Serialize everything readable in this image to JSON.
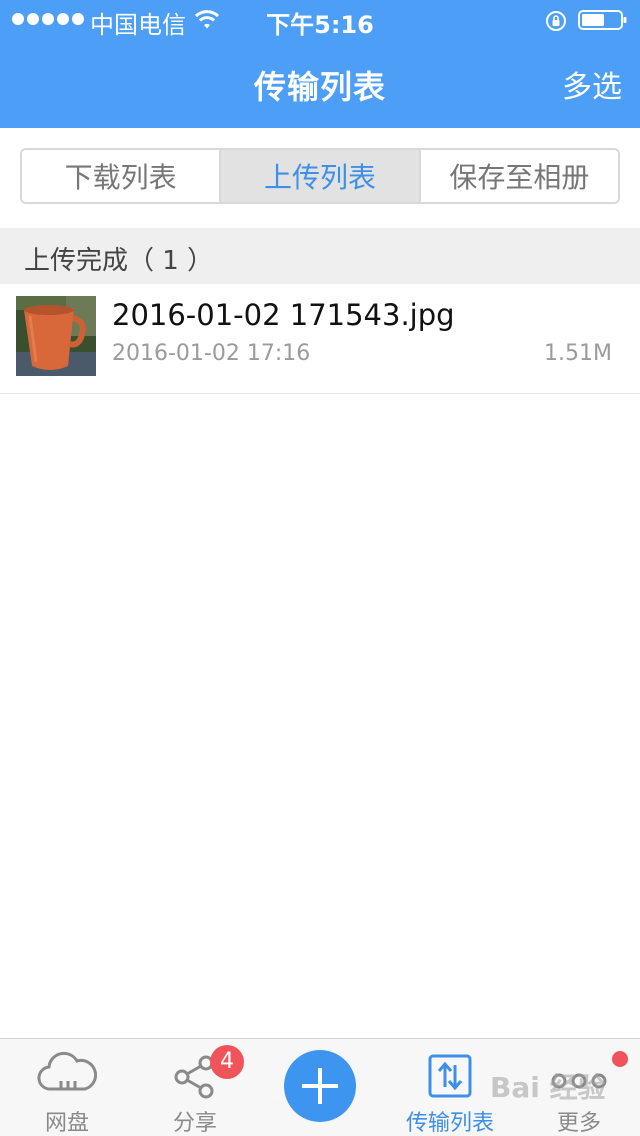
{
  "status_bar": {
    "carrier": "中国电信",
    "time": "下午5:16"
  },
  "nav": {
    "title": "传输列表",
    "multiselect_label": "多选"
  },
  "segments": {
    "download": "下载列表",
    "upload": "上传列表",
    "save_album": "保存至相册",
    "active": "upload"
  },
  "section": {
    "title": "上传完成（ 1 ）"
  },
  "files": [
    {
      "name": "2016-01-02 171543.jpg",
      "date": "2016-01-02 17:16",
      "size": "1.51M"
    }
  ],
  "tab_bar": {
    "cloud_label": "网盘",
    "share_label": "分享",
    "share_badge": "4",
    "transfer_label": "传输列表",
    "more_label": "更多",
    "active": "transfer"
  },
  "watermark": "Bai 经验",
  "colors": {
    "header_blue": "#4d9ef7",
    "accent_blue": "#3d8fe8",
    "badge_red": "#f0545a"
  }
}
